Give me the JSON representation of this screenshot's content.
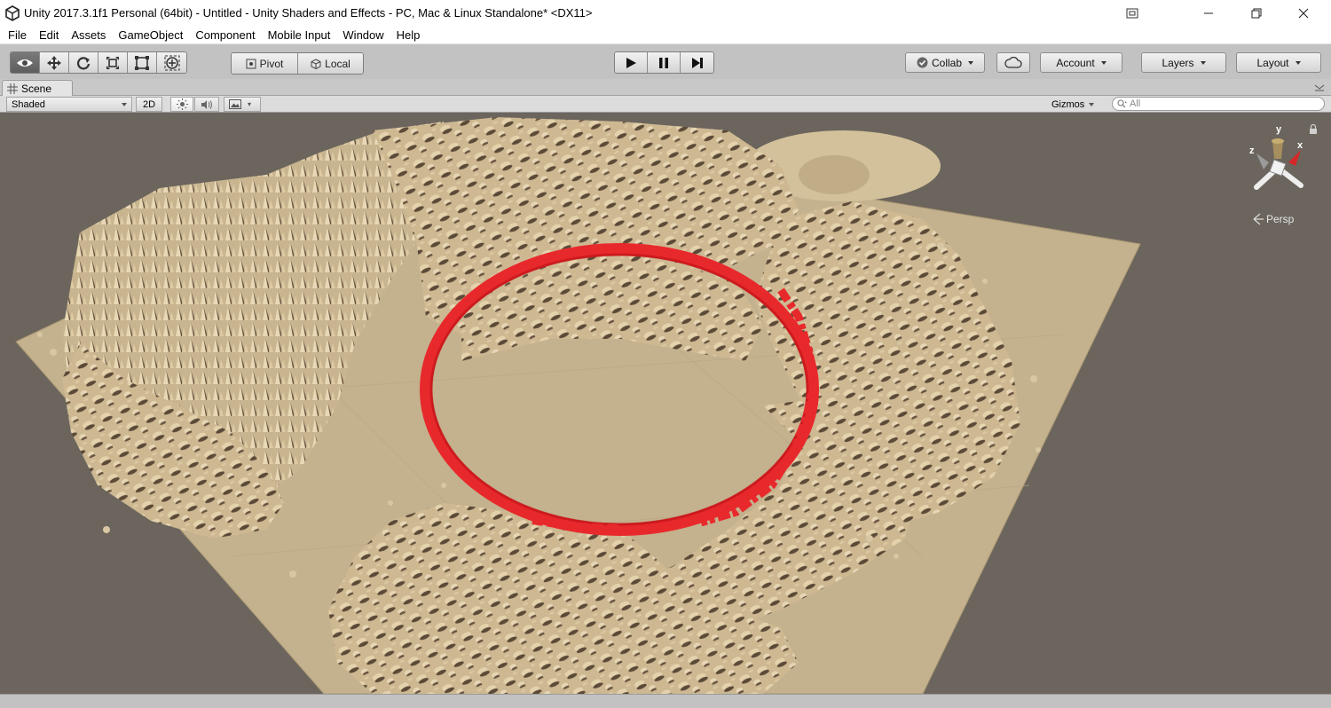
{
  "window": {
    "title": "Unity 2017.3.1f1 Personal (64bit) - Untitled - Unity Shaders and Effects - PC, Mac & Linux Standalone* <DX11>"
  },
  "menu": [
    "File",
    "Edit",
    "Assets",
    "GameObject",
    "Component",
    "Mobile Input",
    "Window",
    "Help"
  ],
  "toolbar": {
    "pivot_label": "Pivot",
    "local_label": "Local",
    "collab_label": "Collab",
    "account_label": "Account",
    "layers_label": "Layers",
    "layout_label": "Layout"
  },
  "scene": {
    "tab_label": "Scene",
    "shading_mode": "Shaded",
    "mode_2d_label": "2D",
    "gizmos_label": "Gizmos",
    "search_placeholder": "All",
    "projection_label": "Persp",
    "gizmo_axes": {
      "y": "y",
      "x": "x",
      "z": "z"
    }
  },
  "colors": {
    "terrain": "#c9b48e",
    "terrain_shadow": "#4a3a2c",
    "ring": "#e8292c",
    "background": "#6b655d",
    "active_tool": "#5e5e5e"
  }
}
